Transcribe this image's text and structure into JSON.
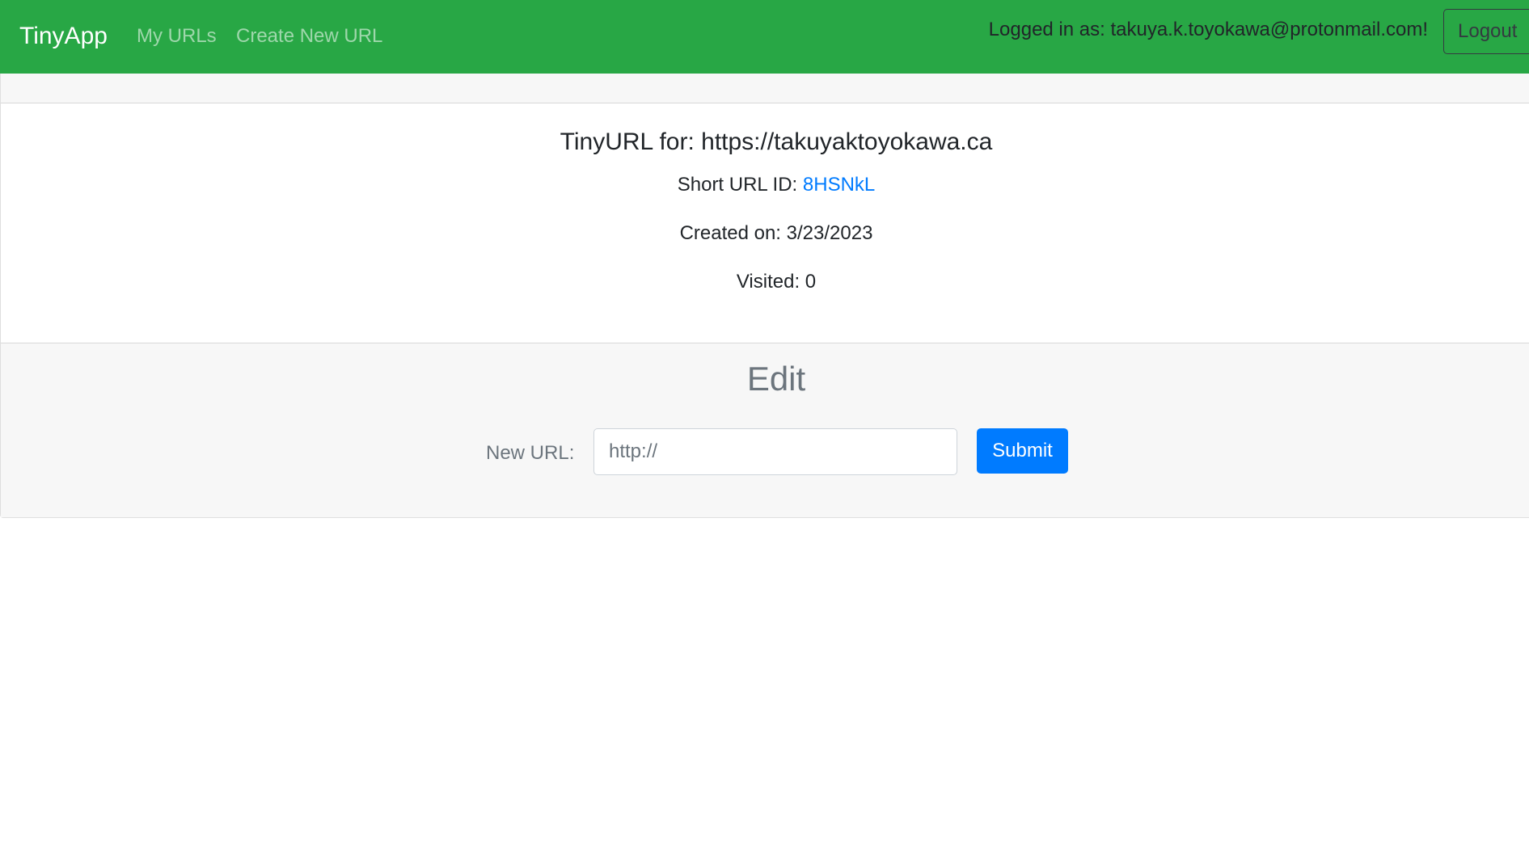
{
  "navbar": {
    "brand": "TinyApp",
    "links": [
      {
        "label": "My URLs"
      },
      {
        "label": "Create New URL"
      }
    ],
    "logged_in_text": "Logged in as: takuya.k.toyokawa@protonmail.com!",
    "logout_label": "Logout",
    "bg_color": "#28a745"
  },
  "url_card": {
    "title": "TinyURL for: https://takuyaktoyokawa.ca",
    "short_id_label": "Short URL ID: ",
    "short_id": "8HSNkL",
    "created_on": "Created on: 3/23/2023",
    "visited": "Visited: 0"
  },
  "edit_form": {
    "heading": "Edit",
    "new_url_label": "New URL:",
    "input_placeholder": "http://",
    "submit_label": "Submit",
    "submit_color": "#007bff"
  }
}
